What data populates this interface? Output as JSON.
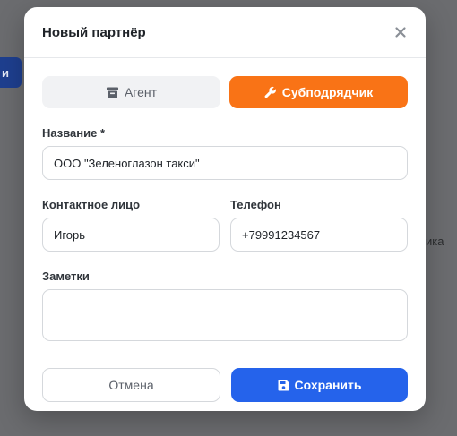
{
  "background": {
    "chip_label": "и",
    "side_text": "ика"
  },
  "modal": {
    "title": "Новый партнёр",
    "close_icon": "close-icon",
    "type_toggle": {
      "agent_label": "Агент",
      "agent_icon": "store-icon",
      "subcontractor_label": "Субподрядчик",
      "subcontractor_icon": "wrench-icon",
      "selected": "subcontractor"
    },
    "fields": {
      "name_label": "Название *",
      "name_value": "ООО \"Зеленоглазон такси\"",
      "contact_label": "Контактное лицо",
      "contact_value": "Игорь",
      "phone_label": "Телефон",
      "phone_value": "+79991234567",
      "notes_label": "Заметки",
      "notes_value": ""
    },
    "footer": {
      "cancel_label": "Отмена",
      "save_label": "Сохранить",
      "save_icon": "floppy-disk-icon"
    }
  },
  "colors": {
    "accent_orange": "#f97316",
    "primary_blue": "#2563eb",
    "overlay": "#6b6c6f"
  }
}
